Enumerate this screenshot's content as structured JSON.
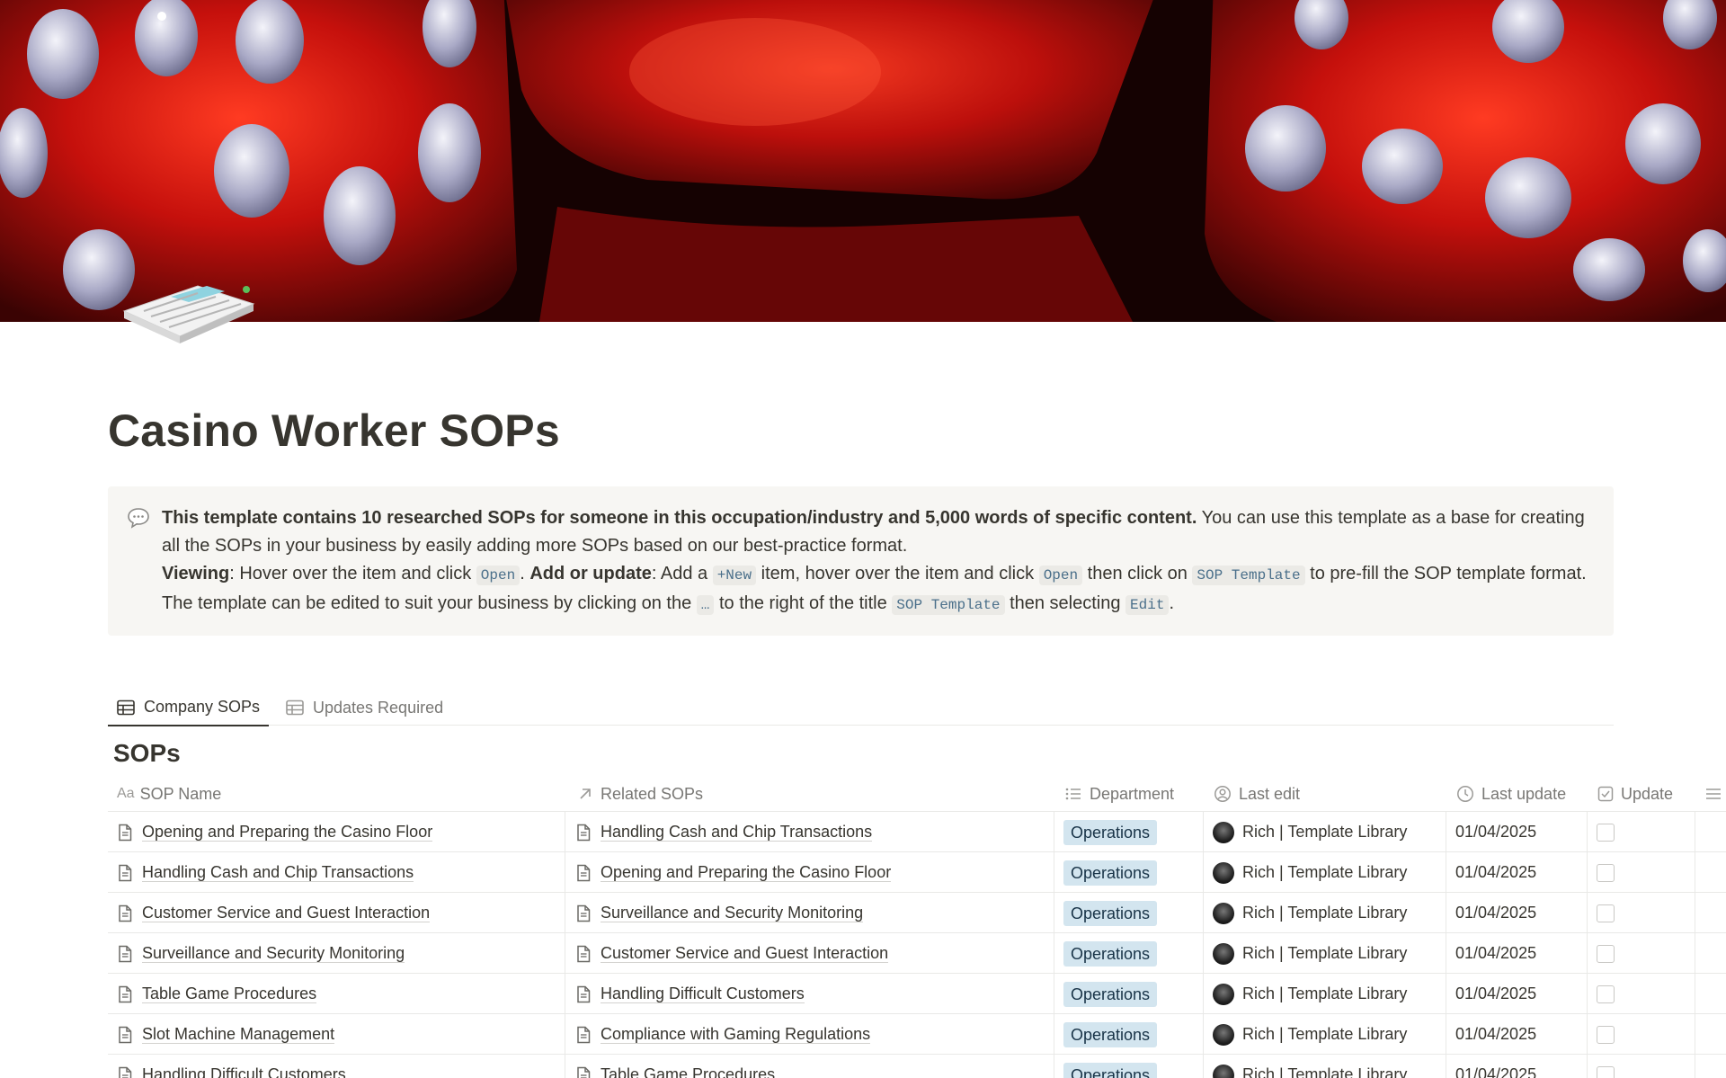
{
  "page": {
    "title": "Casino Worker SOPs"
  },
  "callout": {
    "icon": "speech-bubble-icon",
    "bold_intro": "This template contains 10 researched SOPs for someone in this occupation/industry and 5,000 words of specific content.",
    "intro_rest": " You can use this template as a base for creating all the SOPs in your business by easily adding more SOPs based on our best-practice format.",
    "viewing_label": "Viewing",
    "viewing_text": ": Hover over the item and click ",
    "open_code": "Open",
    "period_sep": ". ",
    "add_label": "Add or update",
    "add_text_1": ": Add a ",
    "new_code": "+New",
    "add_text_2": " item, hover over the item and click ",
    "open_code_2": "Open",
    "add_text_3": " then click on ",
    "sop_template_code": "SOP Template",
    "add_text_4": " to pre-fill the SOP template format. The template can be edited to suit your business by clicking on the ",
    "dots_code": "…",
    "add_text_5": " to the right of the title ",
    "sop_template_code_2": "SOP Template",
    "add_text_6": " then selecting ",
    "edit_code": "Edit",
    "final_period": "."
  },
  "tabs": [
    {
      "label": "Company SOPs",
      "active": true
    },
    {
      "label": "Updates Required",
      "active": false
    }
  ],
  "database": {
    "title": "SOPs",
    "columns": {
      "name": "SOP Name",
      "related": "Related SOPs",
      "department": "Department",
      "last_edit": "Last edit",
      "last_update": "Last update",
      "update": "Update"
    },
    "rows": [
      {
        "name": "Opening and Preparing the Casino Floor",
        "related": "Handling Cash and Chip Transactions",
        "department": "Operations",
        "last_edit": "Rich | Template Library",
        "last_update": "01/04/2025",
        "update": false
      },
      {
        "name": "Handling Cash and Chip Transactions",
        "related": "Opening and Preparing the Casino Floor",
        "department": "Operations",
        "last_edit": "Rich | Template Library",
        "last_update": "01/04/2025",
        "update": false
      },
      {
        "name": "Customer Service and Guest Interaction",
        "related": "Surveillance and Security Monitoring",
        "department": "Operations",
        "last_edit": "Rich | Template Library",
        "last_update": "01/04/2025",
        "update": false
      },
      {
        "name": "Surveillance and Security Monitoring",
        "related": "Customer Service and Guest Interaction",
        "department": "Operations",
        "last_edit": "Rich | Template Library",
        "last_update": "01/04/2025",
        "update": false
      },
      {
        "name": "Table Game Procedures",
        "related": "Handling Difficult Customers",
        "department": "Operations",
        "last_edit": "Rich | Template Library",
        "last_update": "01/04/2025",
        "update": false
      },
      {
        "name": "Slot Machine Management",
        "related": "Compliance with Gaming Regulations",
        "department": "Operations",
        "last_edit": "Rich | Template Library",
        "last_update": "01/04/2025",
        "update": false
      },
      {
        "name": "Handling Difficult Customers",
        "related": "Table Game Procedures",
        "department": "Operations",
        "last_edit": "Rich | Template Library",
        "last_update": "01/04/2025",
        "update": false
      }
    ]
  },
  "colors": {
    "tag_bg": "#d3e5ef",
    "text": "#37352f",
    "muted": "#787774"
  }
}
